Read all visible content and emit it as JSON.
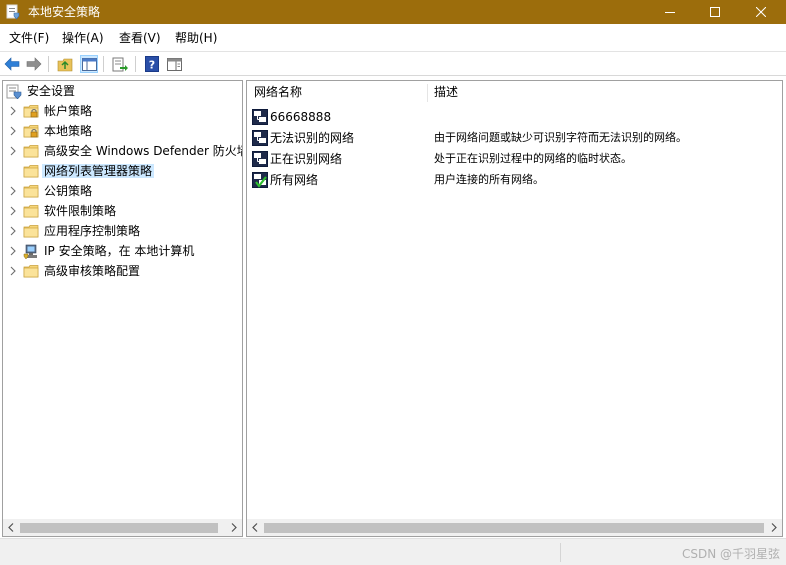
{
  "window": {
    "title": "本地安全策略"
  },
  "menu": [
    "文件(F)",
    "操作(A)",
    "查看(V)",
    "帮助(H)"
  ],
  "tree": [
    {
      "label": "安全设置",
      "icon": "security-settings-icon",
      "level": 0,
      "has_chevron": false
    },
    {
      "label": "帐户策略",
      "icon": "folder-lock-icon",
      "level": 1,
      "has_chevron": true
    },
    {
      "label": "本地策略",
      "icon": "folder-lock-icon",
      "level": 1,
      "has_chevron": true
    },
    {
      "label": "高级安全 Windows Defender 防火墙",
      "icon": "folder-icon",
      "level": 1,
      "has_chevron": true
    },
    {
      "label": "网络列表管理器策略",
      "icon": "folder-icon",
      "level": 1,
      "has_chevron": false,
      "selected": true
    },
    {
      "label": "公钥策略",
      "icon": "folder-icon",
      "level": 1,
      "has_chevron": true
    },
    {
      "label": "软件限制策略",
      "icon": "folder-icon",
      "level": 1,
      "has_chevron": true
    },
    {
      "label": "应用程序控制策略",
      "icon": "folder-icon",
      "level": 1,
      "has_chevron": true
    },
    {
      "label": "IP 安全策略，在 本地计算机",
      "icon": "ip-security-icon",
      "level": 1,
      "has_chevron": true
    },
    {
      "label": "高级审核策略配置",
      "icon": "folder-icon",
      "level": 1,
      "has_chevron": true
    }
  ],
  "list": {
    "columns": [
      "网络名称",
      "描述"
    ],
    "rows": [
      {
        "name": "66668888",
        "desc": "",
        "icon": "network-icon"
      },
      {
        "name": "无法识别的网络",
        "desc": "由于网络问题或缺少可识别字符而无法识别的网络。",
        "icon": "network-icon"
      },
      {
        "name": "正在识别网络",
        "desc": "处于正在识别过程中的网络的临时状态。",
        "icon": "network-icon"
      },
      {
        "name": "所有网络",
        "desc": "用户连接的所有网络。",
        "icon": "network-check-icon"
      }
    ]
  },
  "watermark": "CSDN @千羽星弦",
  "colors": {
    "titlebar": "#9c6d0c",
    "selection": "#cce8ff"
  }
}
